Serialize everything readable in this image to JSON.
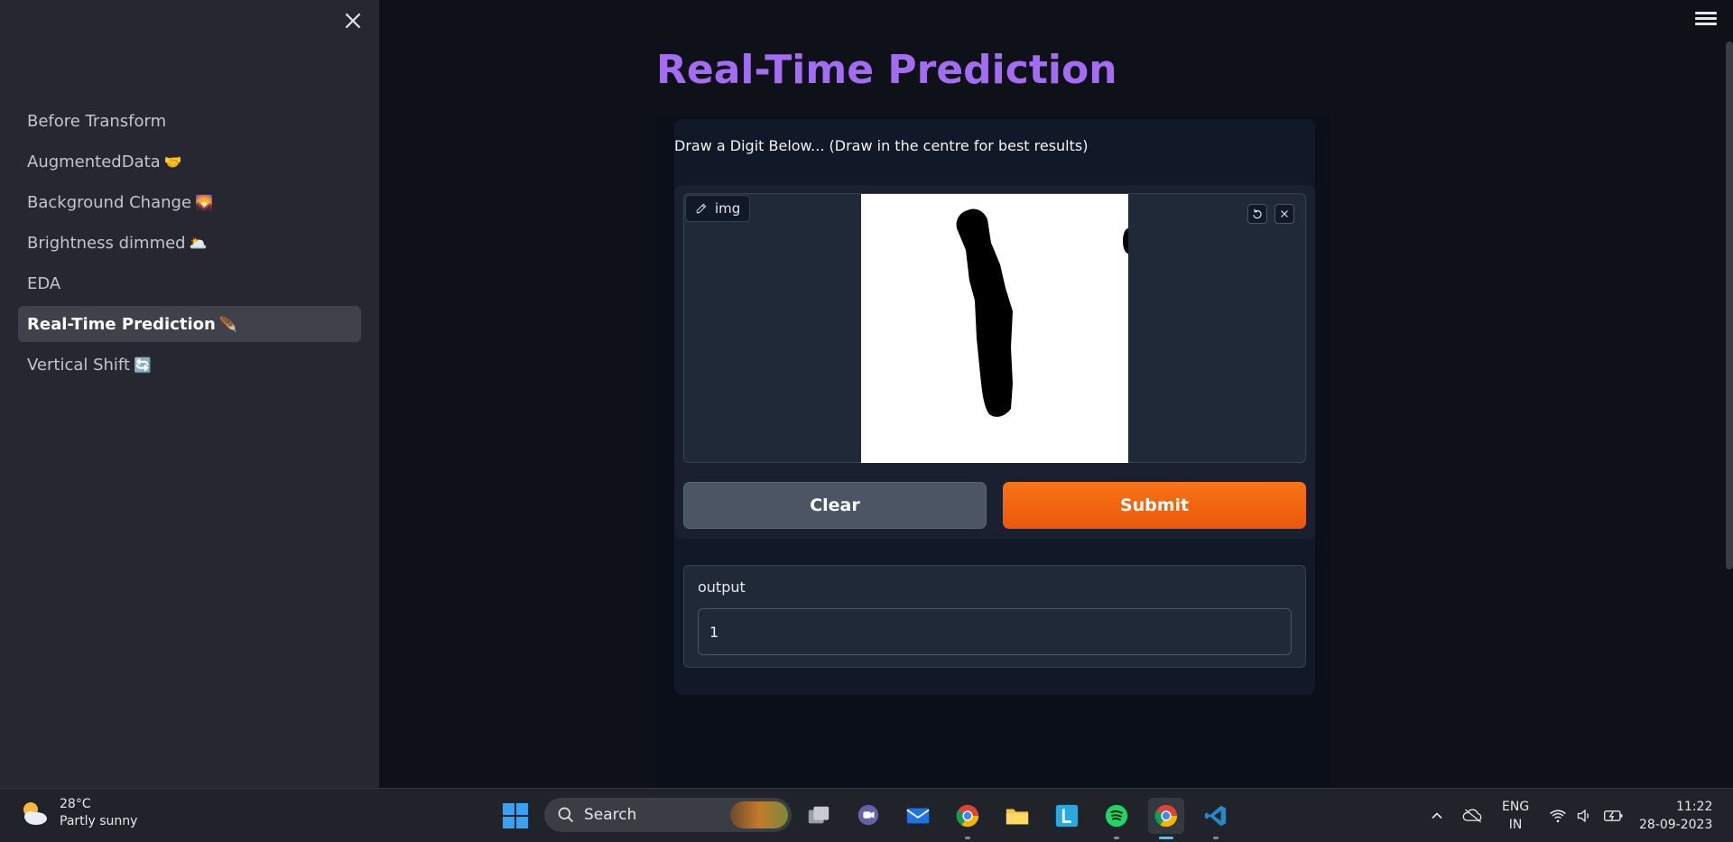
{
  "sidebar": {
    "items": [
      {
        "label": "Before Transform",
        "emoji": "",
        "active": false
      },
      {
        "label": "AugmentedData",
        "emoji": "🤝",
        "active": false
      },
      {
        "label": "Background Change",
        "emoji": "🌄",
        "active": false
      },
      {
        "label": "Brightness dimmed",
        "emoji": "🌥️",
        "active": false
      },
      {
        "label": "EDA",
        "emoji": "",
        "active": false
      },
      {
        "label": "Real-Time Prediction",
        "emoji": "🪶",
        "active": true
      },
      {
        "label": "Vertical Shift",
        "emoji": "🔄",
        "active": false
      }
    ]
  },
  "main": {
    "title": "Real-Time Prediction",
    "instruction": "Draw a Digit Below... (Draw in the centre for best results)",
    "image_input": {
      "label": "img"
    },
    "buttons": {
      "clear": "Clear",
      "submit": "Submit"
    },
    "output": {
      "label": "output",
      "value": "1"
    }
  },
  "taskbar": {
    "weather": {
      "temp": "28°C",
      "condition": "Partly sunny"
    },
    "search_label": "Search",
    "apps": [
      "start-icon",
      "task-view-icon",
      "teams-chat-icon",
      "mail-icon",
      "chrome-icon",
      "file-explorer-icon",
      "l-app-icon",
      "spotify-icon",
      "chrome-icon",
      "vscode-icon"
    ],
    "tray": {
      "lang_line1": "ENG",
      "lang_line2": "IN",
      "time": "11:22",
      "date": "28-09-2023"
    }
  },
  "colors": {
    "title": "#a36cf2",
    "submit": "#f97316",
    "sidebar_bg": "#262730",
    "app_bg": "#0e1117"
  }
}
